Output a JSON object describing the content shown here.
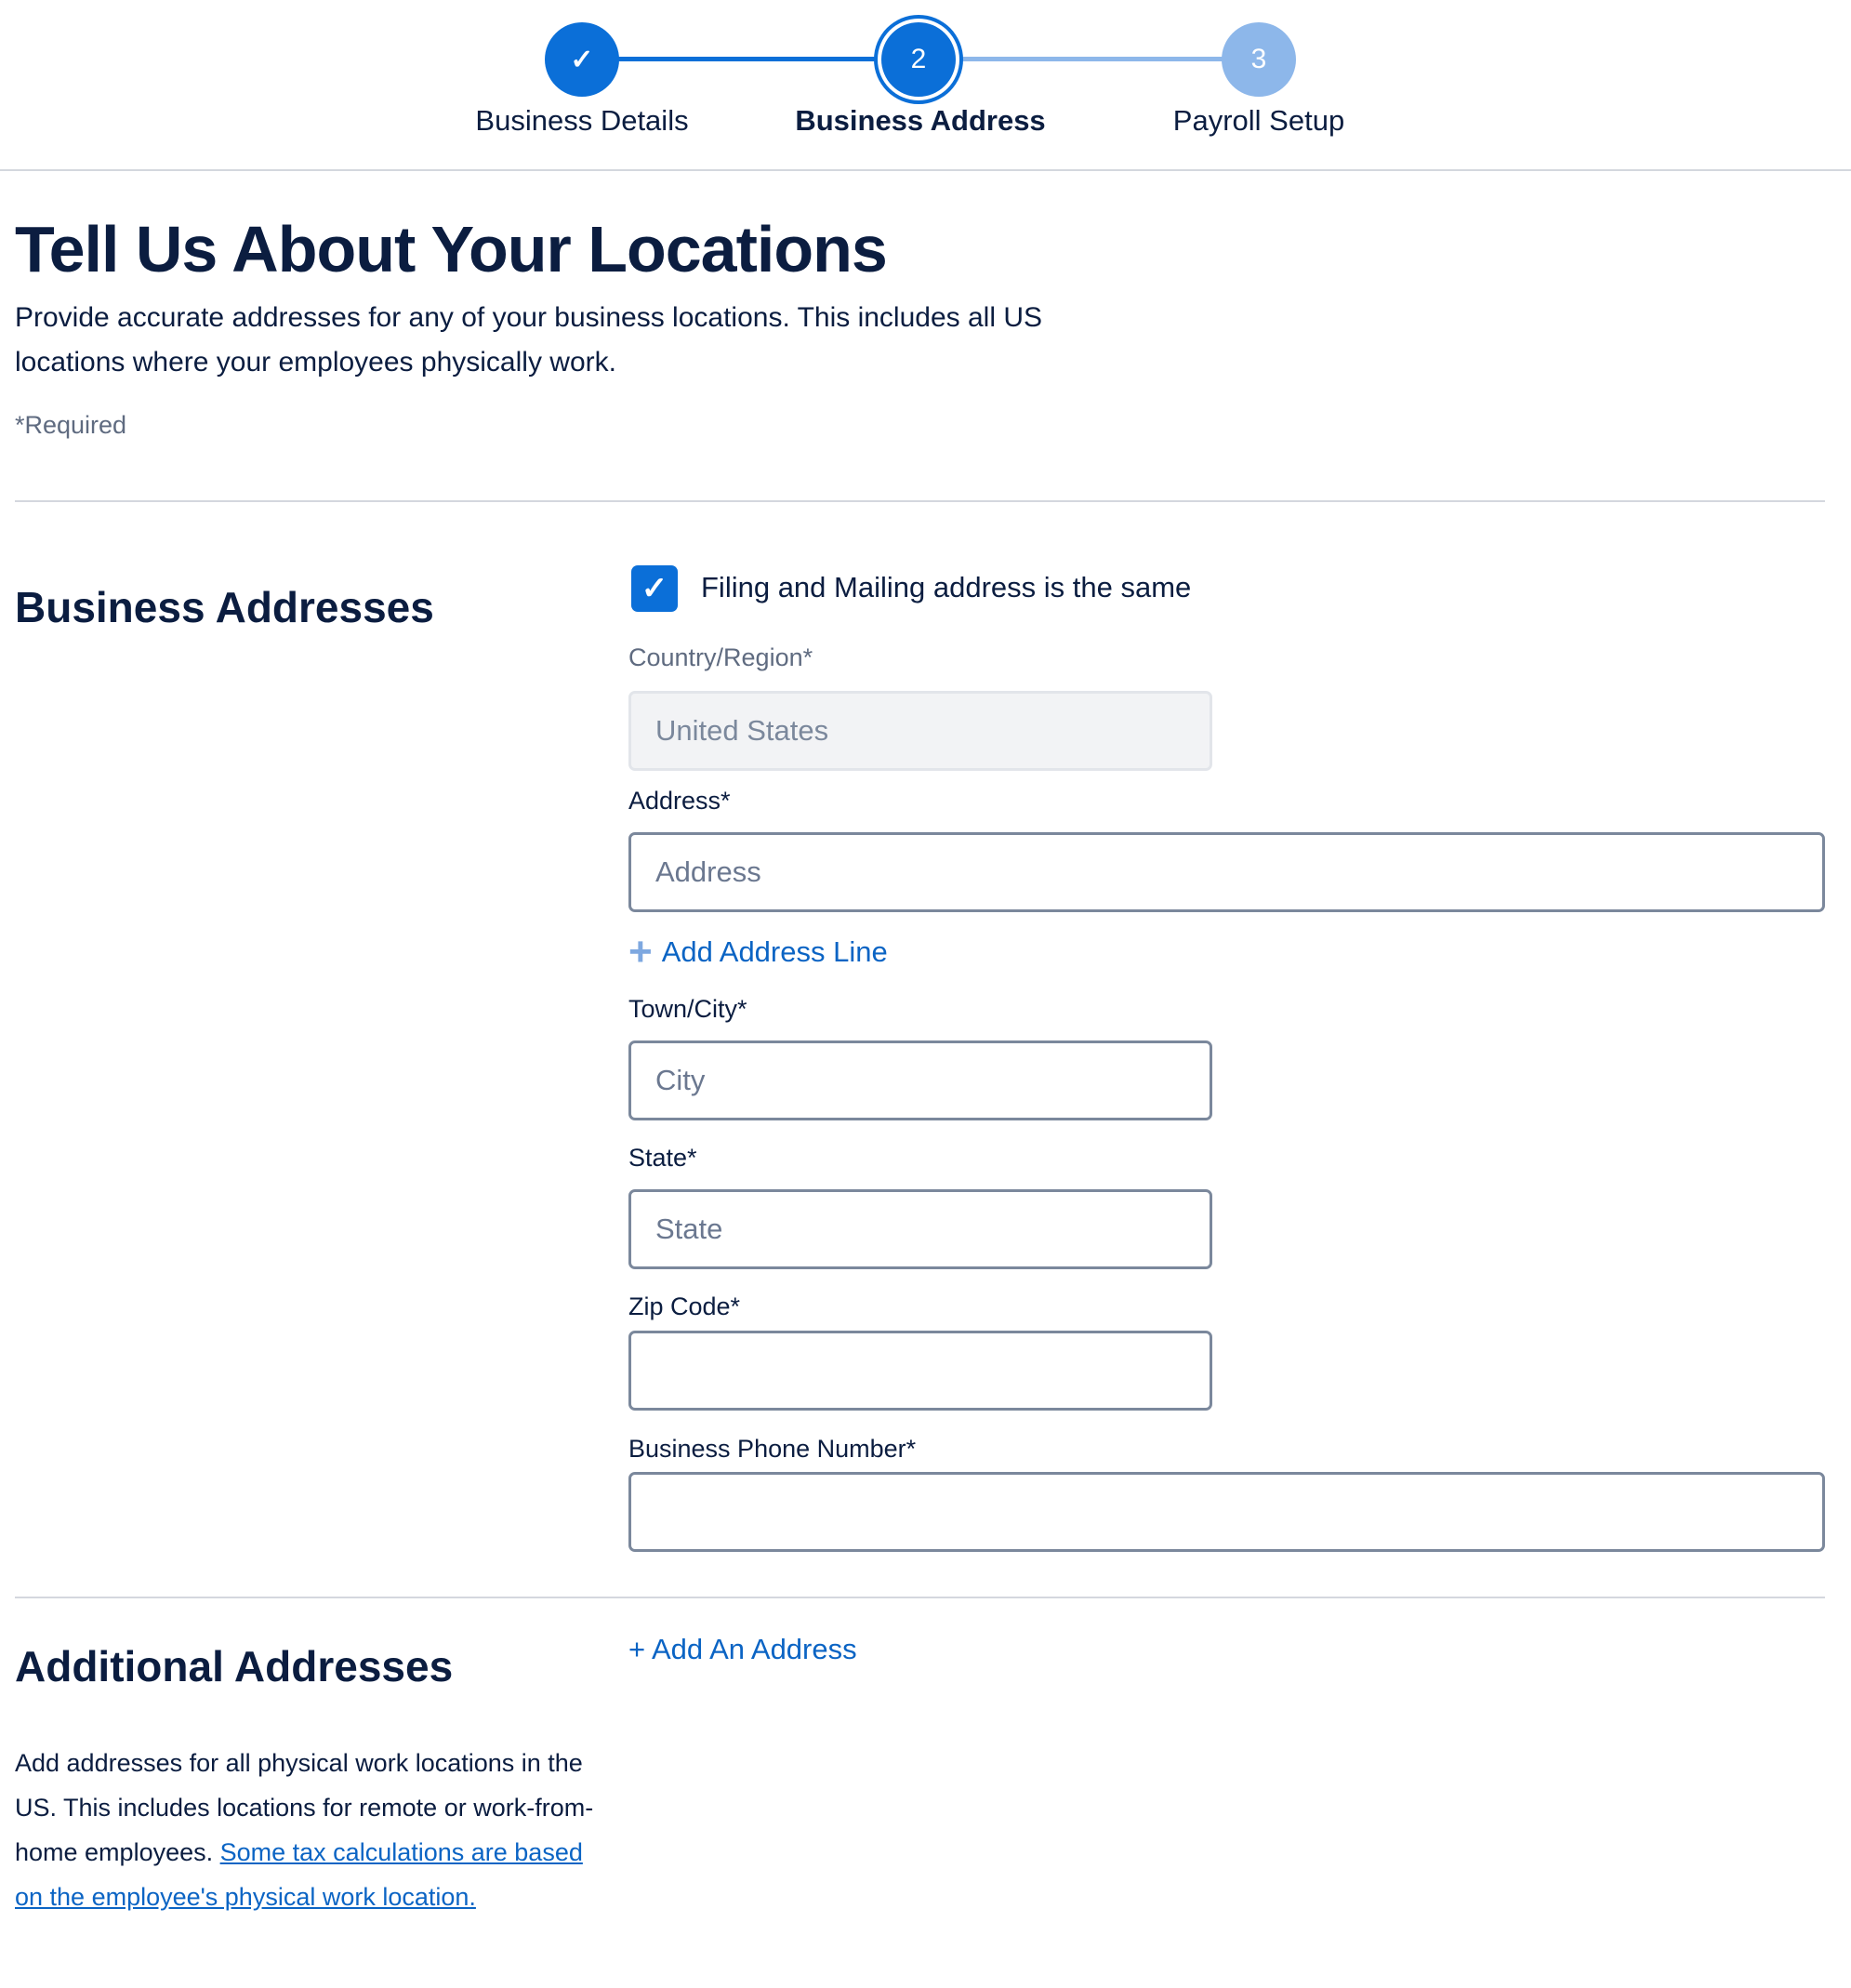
{
  "stepper": {
    "steps": [
      {
        "label": "Business Details",
        "marker": "✓",
        "status": "complete"
      },
      {
        "label": "Business Address",
        "marker": "2",
        "status": "current"
      },
      {
        "label": "Payroll Setup",
        "marker": "3",
        "status": "upcoming"
      }
    ]
  },
  "header": {
    "title": "Tell Us About Your Locations",
    "description": "Provide accurate addresses for any of your business locations. This includes all US locations where your employees physically work.",
    "required_note": "*Required"
  },
  "business_addresses": {
    "title": "Business Addresses",
    "same_address_checkbox": {
      "label": "Filing and Mailing address is the same",
      "checked": true,
      "glyph": "✓"
    },
    "country": {
      "label": "Country/Region*",
      "value": "United States"
    },
    "address": {
      "label": "Address*",
      "placeholder": "Address",
      "value": ""
    },
    "add_address_line": {
      "icon": "+",
      "label": "Add Address Line"
    },
    "city": {
      "label": "Town/City*",
      "placeholder": "City",
      "value": ""
    },
    "state": {
      "label": "State*",
      "placeholder": "State",
      "value": ""
    },
    "zip": {
      "label": "Zip Code*",
      "placeholder": "",
      "value": ""
    },
    "phone": {
      "label": "Business Phone Number*",
      "placeholder": "",
      "value": ""
    }
  },
  "additional_addresses": {
    "title": "Additional Addresses",
    "add_button": "+ Add An Address",
    "description": "Add addresses for all physical work locations in the US. This includes locations for remote or work-from-home employees. ",
    "link_text": "Some tax calculations are based on the employee's physical work location."
  },
  "colors": {
    "primary": "#0b6fd8",
    "primary_light": "#8db7ea",
    "link": "#0b64c4",
    "text": "#0b1d40",
    "input_border": "#7b889c"
  }
}
